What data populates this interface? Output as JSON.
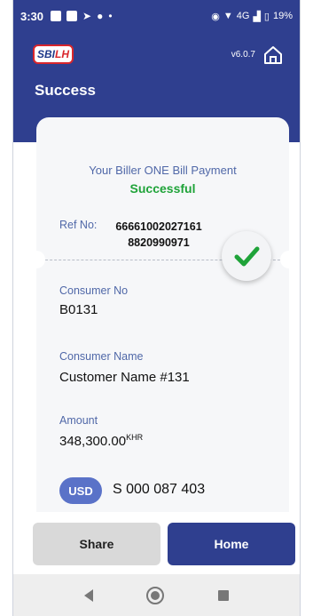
{
  "status_bar": {
    "time": "3:30",
    "network": "4G",
    "battery": "19%"
  },
  "header": {
    "logo_main": "SBI",
    "logo_sub": "LH",
    "version": "v6.0.7",
    "title": "Success"
  },
  "receipt": {
    "payment_title": "Your Biller ONE Bill Payment",
    "payment_status": "Successful",
    "ref_label": "Ref No:",
    "ref_value_line1": "66661002027161",
    "ref_value_line2": "8820990971",
    "consumer_no_label": "Consumer No",
    "consumer_no_value": "B0131",
    "consumer_name_label": "Consumer Name",
    "consumer_name_value": "Customer Name #131",
    "amount_label": "Amount",
    "amount_value": "348,300.00",
    "amount_currency": "KHR",
    "usd_badge": "USD",
    "usd_value": "S 000 087 403"
  },
  "actions": {
    "share_label": "Share",
    "home_label": "Home"
  },
  "colors": {
    "primary": "#2f3f8f",
    "success": "#1fa339",
    "label": "#5068a8"
  }
}
